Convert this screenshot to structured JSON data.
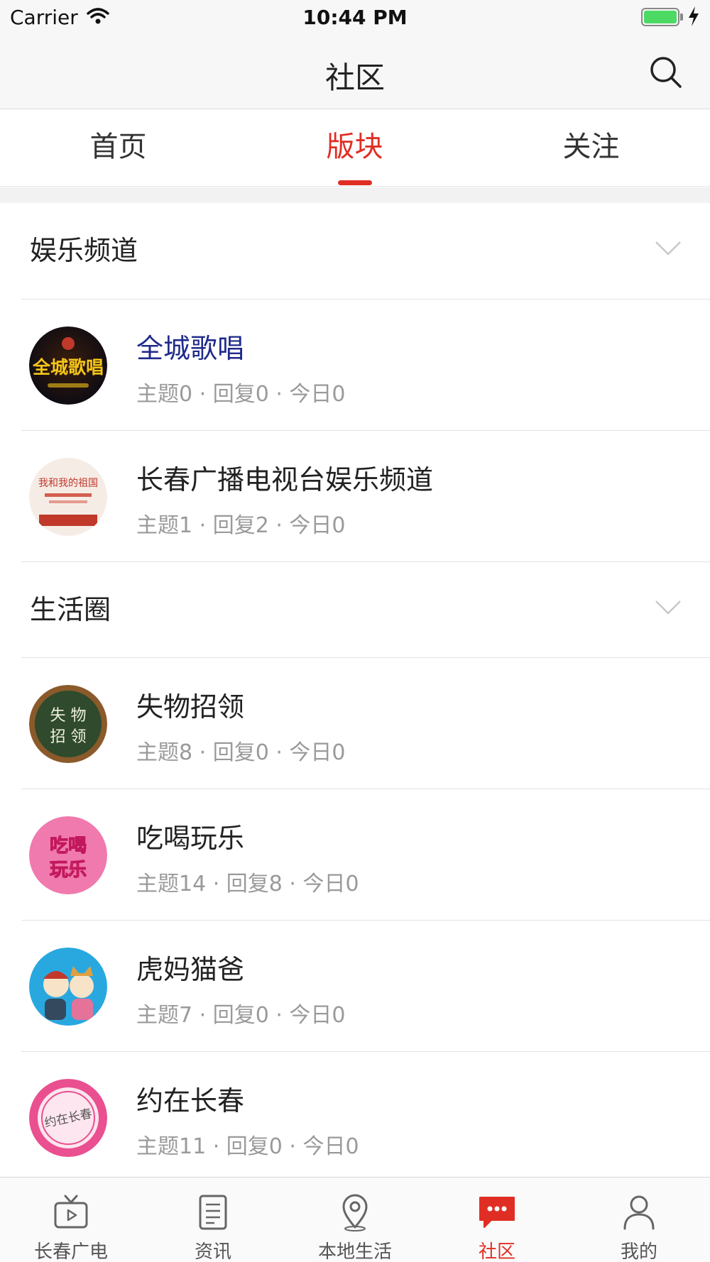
{
  "status_bar": {
    "carrier": "Carrier",
    "time": "10:44 PM"
  },
  "nav": {
    "title": "社区"
  },
  "tabs": [
    {
      "label": "首页"
    },
    {
      "label": "版块"
    },
    {
      "label": "关注"
    }
  ],
  "active_tab": "版块",
  "sections": [
    {
      "title": "娱乐频道",
      "boards": [
        {
          "name": "全城歌唱",
          "stats": "主题0 · 回复0 · 今日0",
          "avatar_caption": "全城歌唱"
        },
        {
          "name": "长春广播电视台娱乐频道",
          "stats": "主题1 · 回复2 · 今日0",
          "avatar_caption": "我和我的祖国"
        }
      ]
    },
    {
      "title": "生活圈",
      "boards": [
        {
          "name": "失物招领",
          "stats": "主题8 · 回复0 · 今日0",
          "avatar_caption": "失物招领"
        },
        {
          "name": "吃喝玩乐",
          "stats": "主题14 · 回复8 · 今日0",
          "avatar_caption": "吃喝玩乐"
        },
        {
          "name": "虎妈猫爸",
          "stats": "主题7 · 回复0 · 今日0",
          "avatar_caption": ""
        },
        {
          "name": "约在长春",
          "stats": "主题11 · 回复0 · 今日0",
          "avatar_caption": "约在长春"
        }
      ]
    }
  ],
  "bottom_tabs": [
    {
      "label": "长春广电",
      "icon": "tv-icon"
    },
    {
      "label": "资讯",
      "icon": "news-list-icon"
    },
    {
      "label": "本地生活",
      "icon": "location-pin-icon"
    },
    {
      "label": "社区",
      "icon": "chat-bubble-icon"
    },
    {
      "label": "我的",
      "icon": "user-profile-icon"
    }
  ],
  "colors": {
    "accent": "#e02e24",
    "highlight_link": "#1f2a8a",
    "muted_text": "#9a9a9a"
  }
}
